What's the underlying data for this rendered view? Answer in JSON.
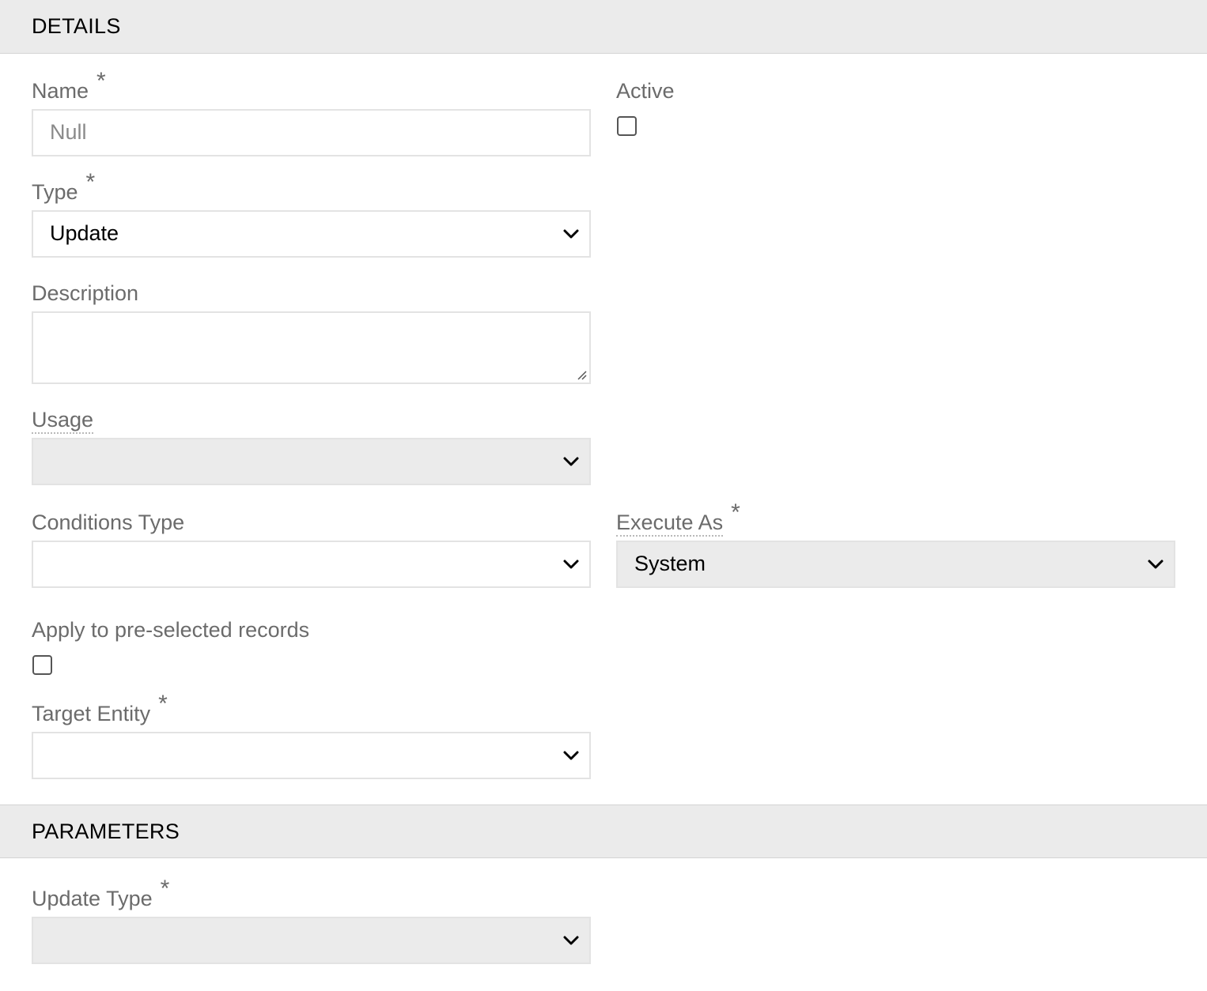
{
  "sections": {
    "details": "DETAILS",
    "parameters": "PARAMETERS"
  },
  "fields": {
    "name": {
      "label": "Name",
      "required": "*",
      "placeholder": "Null",
      "value": ""
    },
    "active": {
      "label": "Active",
      "checked": false
    },
    "type": {
      "label": "Type",
      "required": "*",
      "value": "Update"
    },
    "description": {
      "label": "Description",
      "value": ""
    },
    "usage": {
      "label": "Usage",
      "value": ""
    },
    "conditions_type": {
      "label": "Conditions Type",
      "value": ""
    },
    "execute_as": {
      "label": "Execute As",
      "required": "*",
      "value": "System"
    },
    "apply_preselected": {
      "label": "Apply to pre-selected records",
      "checked": false
    },
    "target_entity": {
      "label": "Target Entity",
      "required": "*",
      "value": ""
    },
    "update_type": {
      "label": "Update Type",
      "required": "*",
      "value": ""
    }
  },
  "icons": {
    "select": "chevron-down-icon",
    "required": "asterisk-icon",
    "textarea": "resize-handle-icon"
  }
}
